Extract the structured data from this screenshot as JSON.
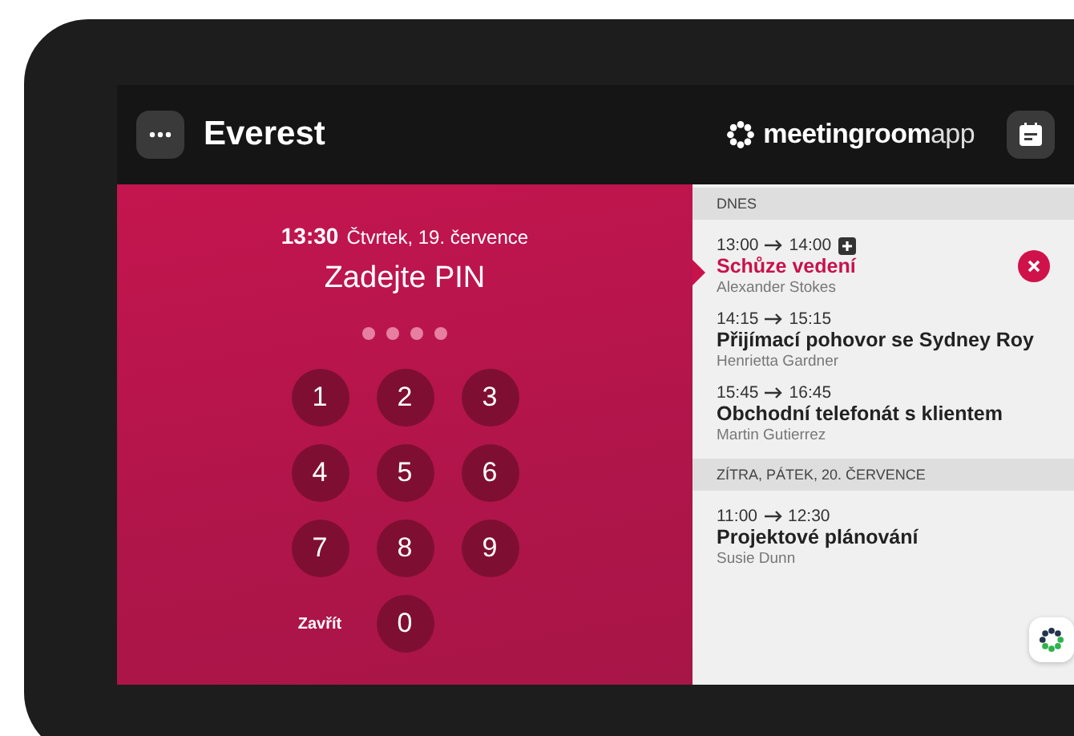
{
  "header": {
    "room": "Everest",
    "brand_bold": "meetingroom",
    "brand_light": "app"
  },
  "pin_panel": {
    "time": "13:30",
    "date": "Čtvrtek, 19. července",
    "prompt": "Zadejte PIN",
    "dots": [
      {
        "filled": false
      },
      {
        "filled": false
      },
      {
        "filled": false
      },
      {
        "filled": false
      }
    ],
    "keys": [
      {
        "kind": "digit",
        "label": "1"
      },
      {
        "kind": "digit",
        "label": "2"
      },
      {
        "kind": "digit",
        "label": "3"
      },
      {
        "kind": "digit",
        "label": "4"
      },
      {
        "kind": "digit",
        "label": "5"
      },
      {
        "kind": "digit",
        "label": "6"
      },
      {
        "kind": "digit",
        "label": "7"
      },
      {
        "kind": "digit",
        "label": "8"
      },
      {
        "kind": "digit",
        "label": "9"
      },
      {
        "kind": "text",
        "label": "Zavřít"
      },
      {
        "kind": "digit",
        "label": "0"
      },
      {
        "kind": "empty"
      }
    ]
  },
  "schedule": [
    {
      "heading": "DNES",
      "events": [
        {
          "start": "13:00",
          "end": "14:00",
          "title": "Schůze vedení",
          "organizer": "Alexander Stokes",
          "selected": true
        },
        {
          "start": "14:15",
          "end": "15:15",
          "title": "Přijímací pohovor se Sydney Roy",
          "organizer": "Henrietta Gardner",
          "selected": false
        },
        {
          "start": "15:45",
          "end": "16:45",
          "title": "Obchodní telefonát s klientem",
          "organizer": "Martin Gutierrez",
          "selected": false
        }
      ]
    },
    {
      "heading": "ZÍTRA, PÁTEK, 20. ČERVENCE",
      "events": [
        {
          "start": "11:00",
          "end": "12:30",
          "title": "Projektové plánování",
          "organizer": "Susie Dunn",
          "selected": false
        }
      ]
    }
  ]
}
